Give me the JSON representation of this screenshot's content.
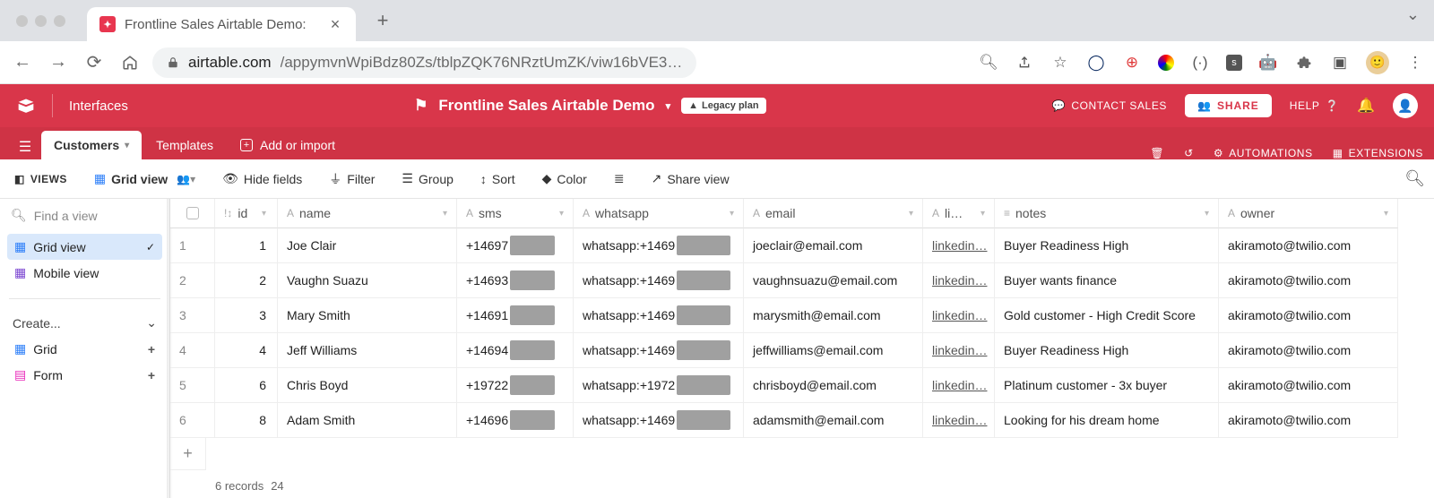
{
  "browser": {
    "tab_title": "Frontline Sales Airtable Demo:",
    "url_host": "airtable.com",
    "url_path": "/appymvnWpiBdz80Zs/tblpZQK76NRztUmZK/viw16bVE3…"
  },
  "topbar": {
    "interfaces": "Interfaces",
    "base_name": "Frontline Sales Airtable Demo",
    "legacy_badge": "Legacy plan",
    "contact_sales": "CONTACT SALES",
    "share": "SHARE",
    "help": "HELP"
  },
  "table_tabs": {
    "active": "Customers",
    "tab2": "Templates",
    "add_import": "Add or import",
    "automations": "AUTOMATIONS",
    "extensions": "EXTENSIONS"
  },
  "view_toolbar": {
    "views": "VIEWS",
    "grid_view": "Grid view",
    "hide_fields": "Hide fields",
    "filter": "Filter",
    "group": "Group",
    "sort": "Sort",
    "color": "Color",
    "share_view": "Share view"
  },
  "sidebar": {
    "find_placeholder": "Find a view",
    "grid_view": "Grid view",
    "mobile_view": "Mobile view",
    "create": "Create...",
    "grid": "Grid",
    "form": "Form"
  },
  "columns": {
    "id": "id",
    "name": "name",
    "sms": "sms",
    "whatsapp": "whatsapp",
    "email": "email",
    "li": "li…",
    "notes": "notes",
    "owner": "owner"
  },
  "rows": [
    {
      "row": "1",
      "id": "1",
      "name": "Joe Clair",
      "sms": "+14697",
      "wa": "whatsapp:+1469",
      "email": "joeclair@email.com",
      "li": "linkedin…",
      "notes": "Buyer Readiness High",
      "owner": "akiramoto@twilio.com"
    },
    {
      "row": "2",
      "id": "2",
      "name": "Vaughn Suazu",
      "sms": "+14693",
      "wa": "whatsapp:+1469",
      "email": "vaughnsuazu@email.com",
      "li": "linkedin…",
      "notes": "Buyer wants finance",
      "owner": "akiramoto@twilio.com"
    },
    {
      "row": "3",
      "id": "3",
      "name": "Mary Smith",
      "sms": "+14691",
      "wa": "whatsapp:+1469",
      "email": "marysmith@email.com",
      "li": "linkedin…",
      "notes": "Gold customer - High Credit Score",
      "owner": "akiramoto@twilio.com"
    },
    {
      "row": "4",
      "id": "4",
      "name": "Jeff Williams",
      "sms": "+14694",
      "wa": "whatsapp:+1469",
      "email": "jeffwilliams@email.com",
      "li": "linkedin…",
      "notes": "Buyer Readiness High",
      "owner": "akiramoto@twilio.com"
    },
    {
      "row": "5",
      "id": "6",
      "name": "Chris Boyd",
      "sms": "+19722",
      "wa": "whatsapp:+1972",
      "email": "chrisboyd@email.com",
      "li": "linkedin…",
      "notes": "Platinum customer - 3x buyer",
      "owner": "akiramoto@twilio.com"
    },
    {
      "row": "6",
      "id": "8",
      "name": "Adam Smith",
      "sms": "+14696",
      "wa": "whatsapp:+1469",
      "email": "adamsmith@email.com",
      "li": "linkedin…",
      "notes": "Looking for his dream home",
      "owner": "akiramoto@twilio.com"
    }
  ],
  "footer": {
    "records_label": "6 records",
    "count": "24"
  }
}
